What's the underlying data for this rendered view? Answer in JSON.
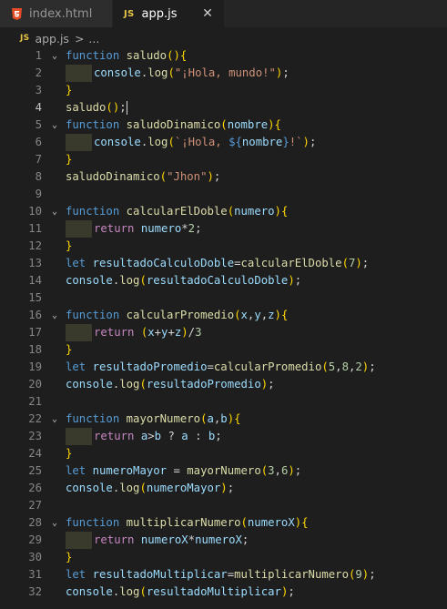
{
  "tabs": [
    {
      "label": "index.html",
      "icon": "html5-icon",
      "active": false
    },
    {
      "label": "app.js",
      "icon": "js-icon",
      "active": true,
      "close": "✕"
    }
  ],
  "breadcrumb": {
    "icon_label": "JS",
    "file": "app.js",
    "separator": ">",
    "trail": "..."
  },
  "editor": {
    "active_line": 4,
    "lines": [
      "function saludo(){",
      "    console.log(\"¡Hola, mundo!\");",
      "}",
      "saludo();",
      "function saludoDinamico(nombre){",
      "    console.log(`¡Hola, ${nombre}!`);",
      "}",
      "saludoDinamico(\"Jhon\");",
      "",
      "function calcularElDoble(numero){",
      "    return numero*2;",
      "}",
      "let resultadoCalculoDoble=calcularElDoble(7);",
      "console.log(resultadoCalculoDoble);",
      "",
      "function calcularPromedio(x,y,z){",
      "    return (x+y+z)/3",
      "}",
      "let resultadoPromedio=calcularPromedio(5,8,2);",
      "console.log(resultadoPromedio);",
      "",
      "function mayorNumero(a,b){",
      "    return a>b ? a : b;",
      "}",
      "let numeroMayor = mayorNumero(3,6);",
      "console.log(numeroMayor);",
      "",
      "function multiplicarNumero(numeroX){",
      "    return numeroX*numeroX;",
      "}",
      "let resultadoMultiplicar=multiplicarNumero(9);",
      "console.log(resultadoMultiplicar);"
    ]
  },
  "colors": {
    "editor_bg": "#1e1e1e",
    "tabbar_bg": "#252526",
    "keyword": "#569cd6",
    "control_keyword": "#c586c0",
    "function": "#dcdcaa",
    "variable": "#9cdcfe",
    "string": "#ce9178",
    "number": "#b5cea8",
    "bracket_1": "#ffd700",
    "bracket_2": "#da70d6",
    "bracket_3": "#179fff",
    "js_icon": "#e7c547",
    "html_icon": "#e44d26"
  }
}
